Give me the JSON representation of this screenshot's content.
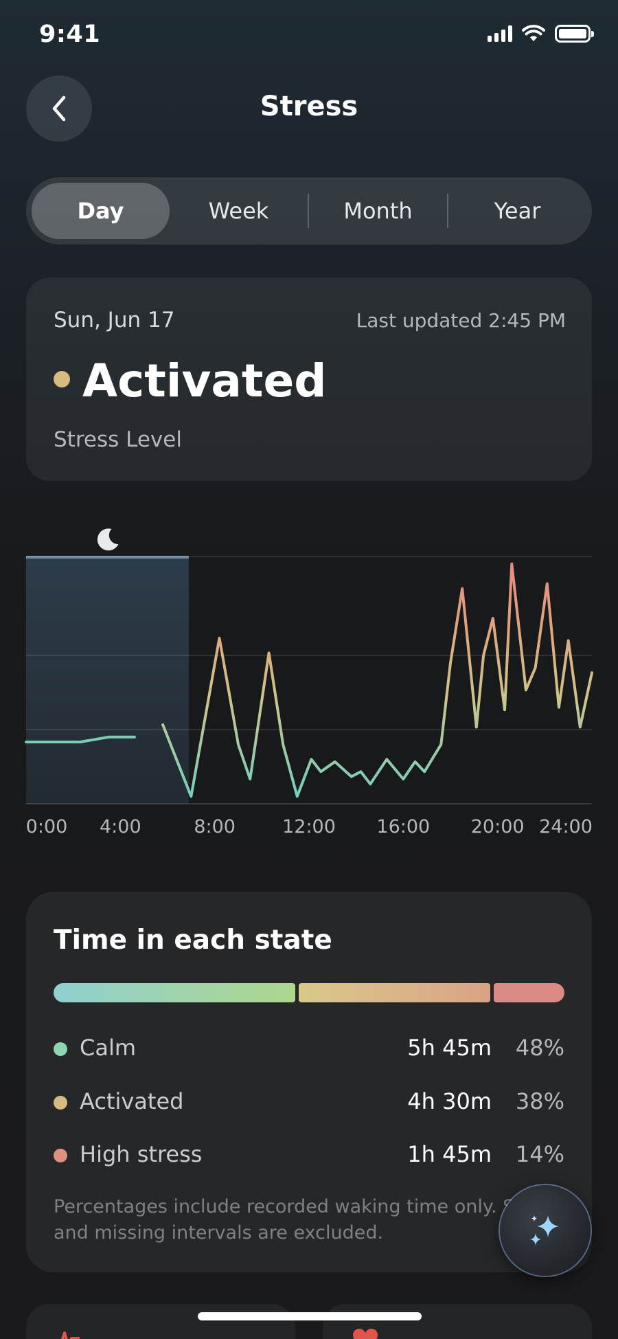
{
  "status_bar": {
    "time": "9:41"
  },
  "header": {
    "title": "Stress"
  },
  "tabs": [
    {
      "label": "Day",
      "active": true
    },
    {
      "label": "Week",
      "active": false
    },
    {
      "label": "Month",
      "active": false
    },
    {
      "label": "Year",
      "active": false
    }
  ],
  "summary": {
    "date": "Sun, Jun 17",
    "last_updated": "Last updated 2:45 PM",
    "state": "Activated",
    "caption": "Stress Level",
    "state_color": "#d8bb80"
  },
  "chart_data": {
    "type": "line",
    "x_tick_labels": [
      "0:00",
      "4:00",
      "8:00",
      "12:00",
      "16:00",
      "20:00",
      "24:00"
    ],
    "xlim": [
      0,
      24
    ],
    "ylim": [
      0,
      100
    ],
    "sleep_interval": {
      "start": 0,
      "end": 6.9
    },
    "colors": {
      "calm": "#7dcdb3",
      "activated": "#d8bb80",
      "high": "#e0907f",
      "sleep_band": "#2c3a47"
    },
    "series": [
      {
        "points": [
          [
            0,
            25
          ],
          [
            2.3,
            25
          ],
          [
            3.5,
            27
          ],
          [
            4.6,
            27
          ]
        ]
      },
      {
        "points": [
          [
            5.8,
            32
          ],
          [
            7.0,
            3
          ],
          [
            8.2,
            67
          ],
          [
            9.0,
            24
          ],
          [
            9.5,
            10
          ],
          [
            10.3,
            61
          ],
          [
            10.9,
            24
          ],
          [
            11.5,
            3
          ],
          [
            12.1,
            18
          ],
          [
            12.5,
            13
          ],
          [
            13.1,
            17
          ],
          [
            13.8,
            11
          ],
          [
            14.2,
            13
          ],
          [
            14.6,
            8
          ],
          [
            15.3,
            18
          ],
          [
            16.0,
            10
          ],
          [
            16.5,
            17
          ],
          [
            16.9,
            13
          ],
          [
            17.6,
            24
          ],
          [
            18.0,
            57
          ],
          [
            18.5,
            87
          ],
          [
            19.1,
            31
          ],
          [
            19.4,
            60
          ],
          [
            19.8,
            75
          ],
          [
            20.3,
            38
          ],
          [
            20.6,
            97
          ],
          [
            21.2,
            46
          ],
          [
            21.6,
            55
          ],
          [
            22.1,
            89
          ],
          [
            22.6,
            39
          ],
          [
            23.0,
            66
          ],
          [
            23.5,
            31
          ],
          [
            24.0,
            53
          ]
        ]
      }
    ]
  },
  "states_card": {
    "title": "Time in each state",
    "rows": [
      {
        "label": "Calm",
        "duration": "5h 45m",
        "percent": "48%",
        "value": 48,
        "color": "#8fd6b0"
      },
      {
        "label": "Activated",
        "duration": "4h 30m",
        "percent": "38%",
        "value": 38,
        "color": "#d8bb80"
      },
      {
        "label": "High stress",
        "duration": "1h 45m",
        "percent": "14%",
        "value": 14,
        "color": "#e0907f"
      }
    ],
    "footnote": "Percentages include recorded waking time only. Sleep and missing intervals are excluded."
  },
  "icons": {
    "back": "chevron-left-icon",
    "sleep": "moon-icon",
    "assistant": "sparkle-icon",
    "heart_rate": "heart-pulse-icon",
    "heart": "heart-icon"
  }
}
